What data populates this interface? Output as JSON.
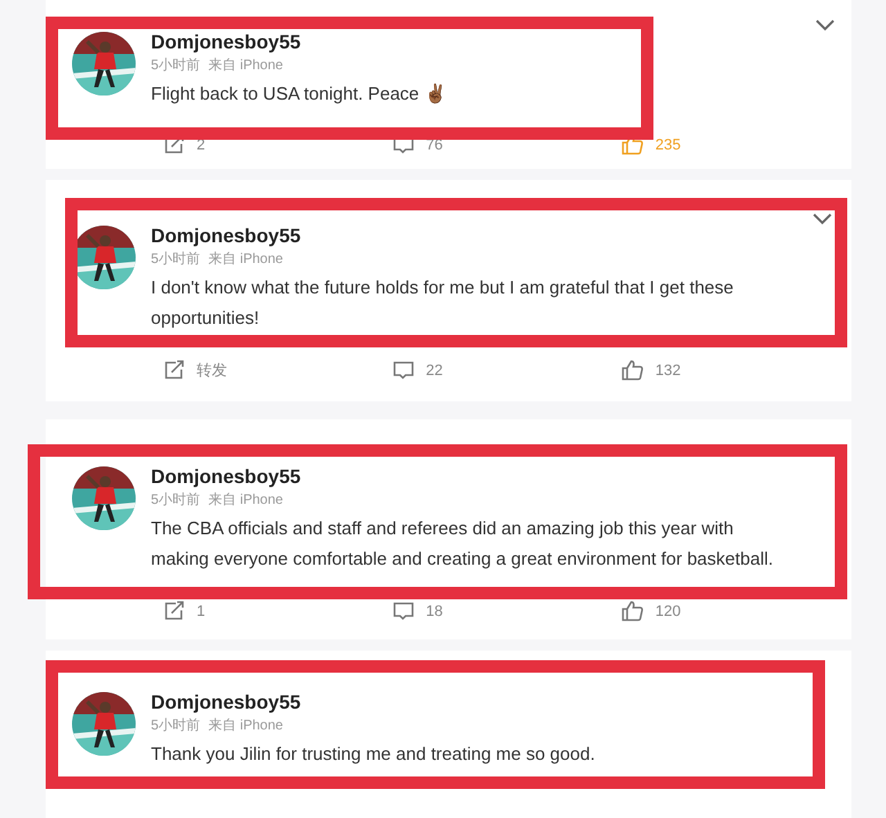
{
  "posts": [
    {
      "username": "Domjonesboy55",
      "time": "5小时前",
      "source": "来自 iPhone",
      "text": "Flight back to USA tonight. Peace ✌🏾",
      "actions": {
        "repost": "2",
        "comments": "76",
        "likes": "235",
        "liked": true
      }
    },
    {
      "username": "Domjonesboy55",
      "time": "5小时前",
      "source": "来自 iPhone",
      "text": "I don't know what the future holds for me but I am grateful that I get these opportunities!",
      "actions": {
        "repost": "转发",
        "comments": "22",
        "likes": "132",
        "liked": false
      }
    },
    {
      "username": "Domjonesboy55",
      "time": "5小时前",
      "source": "来自 iPhone",
      "text": "The CBA officials and staff and referees did an amazing job this year with making everyone comfortable and creating a great environment for basketball.",
      "actions": {
        "repost": "1",
        "comments": "18",
        "likes": "120",
        "liked": false
      }
    },
    {
      "username": "Domjonesboy55",
      "time": "5小时前",
      "source": "来自 iPhone",
      "text": "Thank you Jilin for trusting me and treating me so good."
    }
  ]
}
